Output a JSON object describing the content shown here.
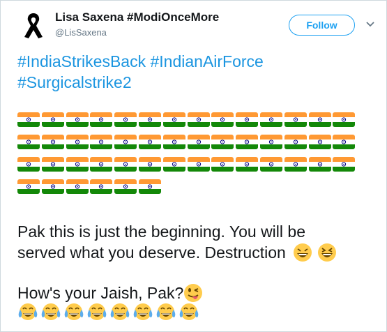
{
  "author": {
    "name": "Lisa Saxena #ModiOnceMore",
    "handle": "@LisSaxena",
    "avatar_icon": "black-ribbon-icon"
  },
  "follow_label": "Follow",
  "menu_icon": "chevron-down-icon",
  "hashtags": {
    "line1": "#IndiaStrikesBack #IndianAirForce",
    "line2": "#Surgicalstrike2"
  },
  "flags": {
    "emoji": "india-flag-emoji",
    "rows": [
      14,
      14,
      14,
      6
    ]
  },
  "message": {
    "line1": "Pak this is just the beginning. You will be",
    "line2": "served what you deserve. Destruction",
    "line2_emojis": [
      "grinning-squinting-emoji",
      "laughing-emoji"
    ],
    "line3": "How's your Jaish, Pak?",
    "line3_emoji": "winking-tongue-emoji",
    "tears_emoji": "tears-of-joy-emoji",
    "tears_count": 8
  },
  "colors": {
    "link": "#1b95e0",
    "accent": "#1da1f2",
    "text": "#14171a",
    "muted": "#657786",
    "saffron": "#ff9933",
    "green": "#138808"
  }
}
